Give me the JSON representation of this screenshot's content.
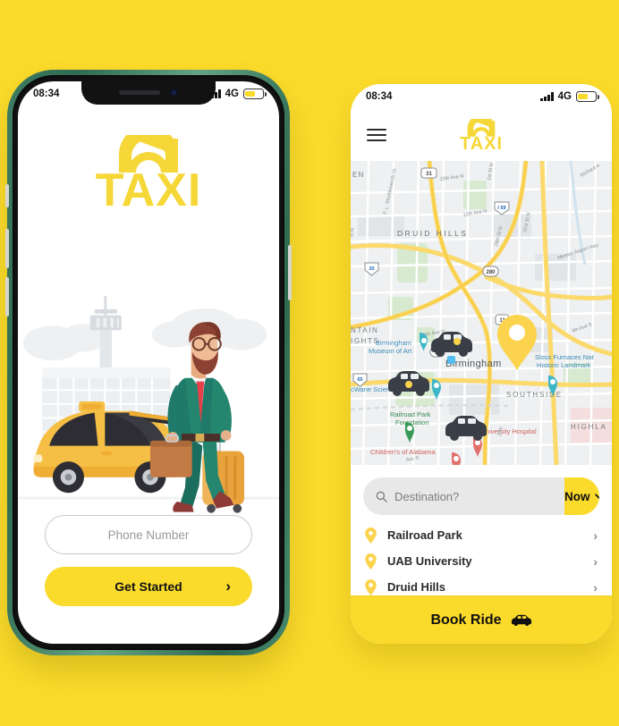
{
  "theme": {
    "background": "#fada2a",
    "accent": "#fada2a",
    "logo_yellow": "#f5d738",
    "frame_green": "#3f7d63",
    "text_dark": "#111111"
  },
  "brand": {
    "name": "TAXI",
    "logo_icon": "taxi-roof-light-icon"
  },
  "screen_onboarding": {
    "status_bar": {
      "time": "08:34",
      "network": "4G",
      "signal_icon": "signal-bars-icon",
      "battery_icon": "battery-icon",
      "battery_level": "58"
    },
    "illustration": {
      "alt": "businessman with luggage next to yellow taxi at airport",
      "car_color": "#f0b53c",
      "suit_color": "#1f7a6a",
      "tie_color": "#e8404a",
      "suitcase_color": "#e8a33d",
      "briefcase_color": "#c37a45"
    },
    "phone_field": {
      "placeholder": "Phone Number",
      "value": ""
    },
    "primary_button": {
      "label": "Get Started",
      "icon": "chevron-right-icon"
    }
  },
  "screen_map": {
    "status_bar": {
      "time": "08:34",
      "network": "4G",
      "signal_icon": "signal-bars-icon",
      "battery_icon": "battery-icon",
      "battery_level": "58"
    },
    "menu_icon": "hamburger-menu-icon",
    "map": {
      "city": "Birmingham",
      "labels": [
        "DRUID HILLS",
        "Birmingham Museum of Art",
        "Sloss Furnaces Nat Historic Landmark",
        "Birmingham",
        "McWane Science Center",
        "Railroad Park Foundation",
        "UAB University Hospital",
        "Children's of Alabama",
        "SOUTHSIDE",
        "HIGHLA",
        "NTAIN",
        "IGHTS",
        "EN"
      ],
      "streets": [
        "15th Ave N",
        "1st St N",
        "12th Ave N",
        "F. L. Shuttlesworth Dr",
        "31st St N",
        "28th St N",
        "Messer Airport Hwy",
        "Richard A",
        "5th Ave N",
        "4th Ave S",
        "20th",
        "Ave S",
        "St N"
      ],
      "shields": [
        "31",
        "I-59",
        "280",
        "11",
        "78",
        "I-65",
        "I-20"
      ],
      "user_marker_icon": "map-pin-marker",
      "car_markers": 3,
      "car_marker_icon": "car-marker-icon"
    },
    "search": {
      "placeholder": "Destination?",
      "value": "",
      "icon": "search-icon"
    },
    "time_selector": {
      "label": "Now",
      "icon": "chevron-down-icon"
    },
    "destinations": [
      {
        "name": "Railroad Park",
        "icon": "location-pin-icon",
        "chevron": "chevron-right-icon"
      },
      {
        "name": "UAB University",
        "icon": "location-pin-icon",
        "chevron": "chevron-right-icon"
      },
      {
        "name": "Druid Hills",
        "icon": "location-pin-icon",
        "chevron": "chevron-right-icon"
      }
    ],
    "book_button": {
      "label": "Book Ride",
      "icon": "car-icon"
    }
  }
}
